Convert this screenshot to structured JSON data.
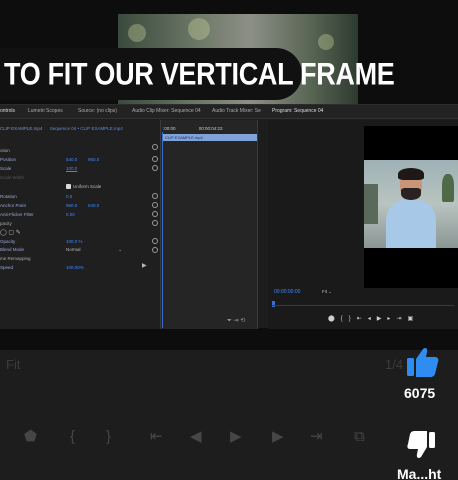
{
  "caption": "TO FIT OUR VERTICAL FRAME",
  "tabs": [
    "ontrols",
    "Lumetri Scopes",
    "Source: (no clips)",
    "Audio Clip Mixer: Sequence 04",
    "Audio Track Mixer: Se",
    "Program: Sequence 04"
  ],
  "effect_controls": {
    "source_clip": "CLIP EXAMPLE.mp4",
    "sequence_clip": "Sequence 04 • CLIP EXAMPLE.mp4",
    "motion": "otion",
    "position_label": "Position",
    "position_x": "540.0",
    "position_y": "960.0",
    "scale_label": "Scale",
    "scale_value": "100.0",
    "scale_width_label": "Scale Width",
    "uniform_scale_label": "Uniform Scale",
    "rotation_label": "Rotation",
    "rotation_value": "0.0",
    "anchor_label": "Anchor Point",
    "anchor_x": "960.0",
    "anchor_y": "540.0",
    "flicker_label": "Anti-Flicker Filter",
    "flicker_value": "0.00",
    "opacity_section": "pacity",
    "opacity_label": "Opacity",
    "opacity_value": "100.0 %",
    "blend_label": "Blend Mode",
    "blend_value": "Normal",
    "remap_section": "me Remapping",
    "speed_label": "Speed",
    "speed_value": "100.00%"
  },
  "timeline": {
    "start_tc": ":00:00",
    "end_tc": "00:00:04:23",
    "clip_label": "CLIP EXAMPLE.mp4"
  },
  "program": {
    "timecode": "00:00:00:00",
    "fit": "Fit"
  },
  "player": {
    "fit_label": "Fit",
    "page_count": "1/4",
    "likes": "6075",
    "author": "Ma...ht"
  }
}
